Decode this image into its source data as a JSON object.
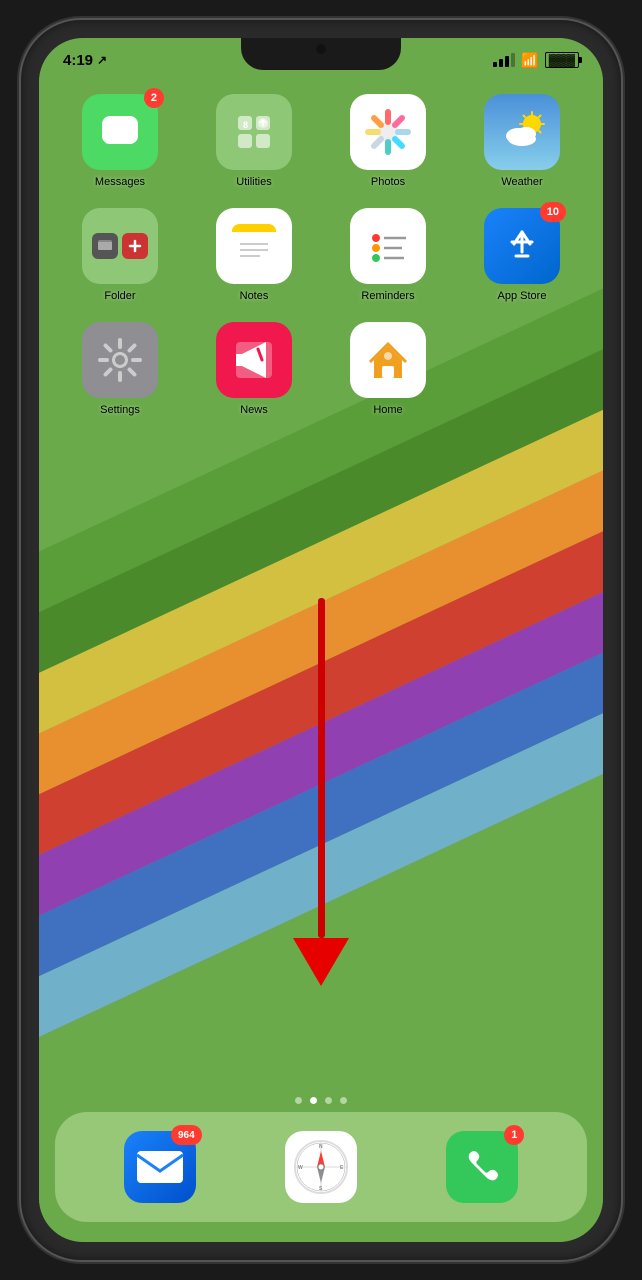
{
  "status": {
    "time": "4:19",
    "location_icon": "›",
    "signal": 3,
    "wifi": true,
    "battery": 80
  },
  "apps": {
    "row1": [
      {
        "id": "messages",
        "label": "Messages",
        "badge": "2",
        "icon_type": "messages"
      },
      {
        "id": "utilities",
        "label": "Utilities",
        "badge": null,
        "icon_type": "utilities"
      },
      {
        "id": "photos",
        "label": "Photos",
        "badge": null,
        "icon_type": "photos"
      },
      {
        "id": "weather",
        "label": "Weather",
        "badge": null,
        "icon_type": "weather"
      }
    ],
    "row2": [
      {
        "id": "folder",
        "label": "Folder",
        "badge": null,
        "icon_type": "folder"
      },
      {
        "id": "notes",
        "label": "Notes",
        "badge": null,
        "icon_type": "notes"
      },
      {
        "id": "reminders",
        "label": "Reminders",
        "badge": null,
        "icon_type": "reminders"
      },
      {
        "id": "appstore",
        "label": "App Store",
        "badge": "10",
        "icon_type": "appstore"
      }
    ],
    "row3": [
      {
        "id": "settings",
        "label": "Settings",
        "badge": null,
        "icon_type": "settings"
      },
      {
        "id": "news",
        "label": "News",
        "badge": null,
        "icon_type": "news"
      },
      {
        "id": "home",
        "label": "Home",
        "badge": null,
        "icon_type": "home"
      },
      {
        "id": "empty",
        "label": "",
        "badge": null,
        "icon_type": "empty"
      }
    ]
  },
  "dock": [
    {
      "id": "mail",
      "label": "Mail",
      "badge": "964",
      "icon_type": "mail"
    },
    {
      "id": "safari",
      "label": "Safari",
      "badge": null,
      "icon_type": "safari"
    },
    {
      "id": "phone",
      "label": "Phone",
      "badge": "1",
      "icon_type": "phone"
    }
  ],
  "page_dots": [
    {
      "active": false
    },
    {
      "active": true
    },
    {
      "active": false
    },
    {
      "active": false
    }
  ],
  "rainbow_colors": [
    "#6aaa4a",
    "#4a9e3a",
    "#5cb85c",
    "#f0c040",
    "#e87820",
    "#cc3030",
    "#9040c0",
    "#4080d0",
    "#80c0d0"
  ],
  "arrow_color": "#cc0000"
}
